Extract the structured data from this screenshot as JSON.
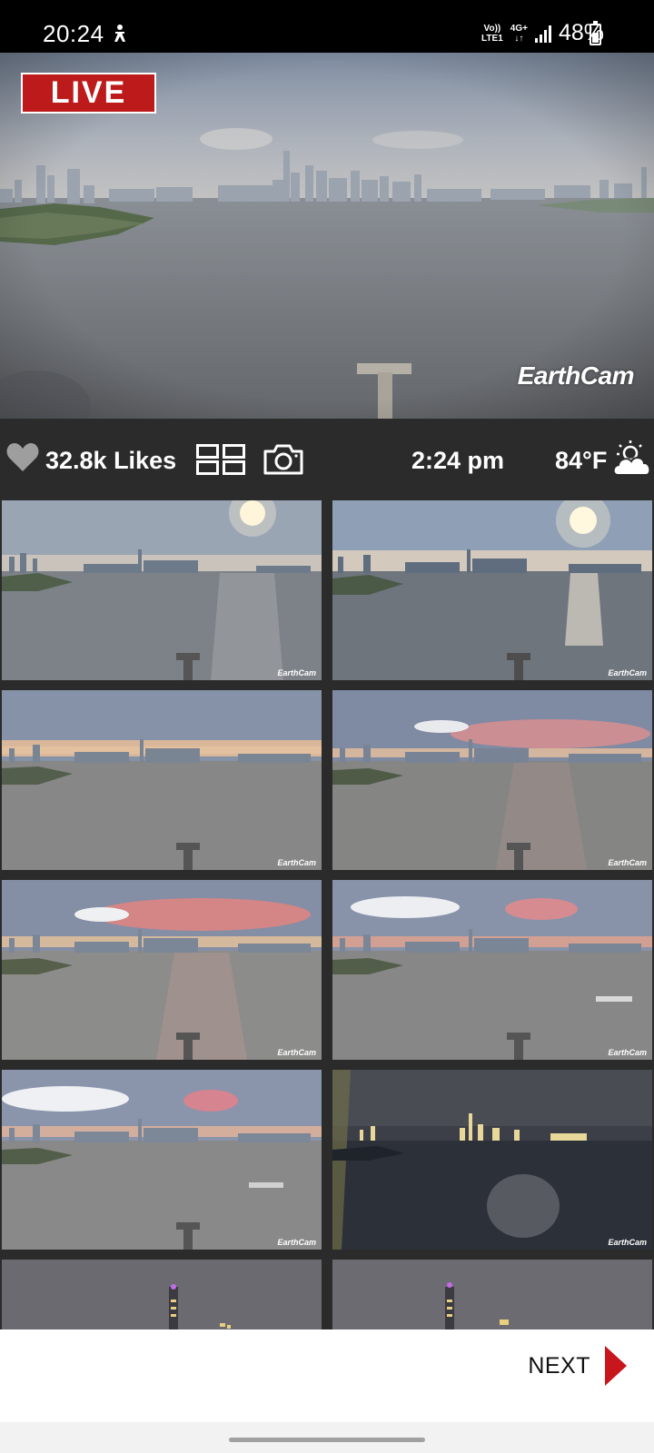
{
  "status_bar": {
    "time": "20:24",
    "volte_line1": "Vo))",
    "volte_line2": "LTE1",
    "network_line1": "4G+",
    "network_line2": "↓↑",
    "battery": "48%"
  },
  "live_cam": {
    "badge": "LIVE",
    "watermark": "EarthCam"
  },
  "info_bar": {
    "likes": "32.8k Likes",
    "local_time": "2:24 pm",
    "temperature": "84°F",
    "icons": [
      "heart-icon",
      "grid-view-icon",
      "camera-icon",
      "partly-cloudy-icon"
    ]
  },
  "thumbnails": [
    {
      "scene": "day-sun",
      "watermark": "EarthCam"
    },
    {
      "scene": "day-sun-bright",
      "watermark": "EarthCam"
    },
    {
      "scene": "dusk-overcast",
      "watermark": "EarthCam"
    },
    {
      "scene": "dusk-pink",
      "watermark": "EarthCam"
    },
    {
      "scene": "sunset-pink",
      "watermark": "EarthCam"
    },
    {
      "scene": "sunset-pink-boat",
      "watermark": "EarthCam"
    },
    {
      "scene": "sunset-boat",
      "watermark": "EarthCam"
    },
    {
      "scene": "night",
      "watermark": "EarthCam"
    },
    {
      "scene": "night-tower",
      "watermark": ""
    },
    {
      "scene": "night-tower",
      "watermark": ""
    }
  ],
  "bottom_bar": {
    "next_label": "NEXT"
  },
  "colors": {
    "live_red": "#bd1b1b",
    "next_arrow": "#c8161d",
    "background": "#2b2b2b"
  }
}
